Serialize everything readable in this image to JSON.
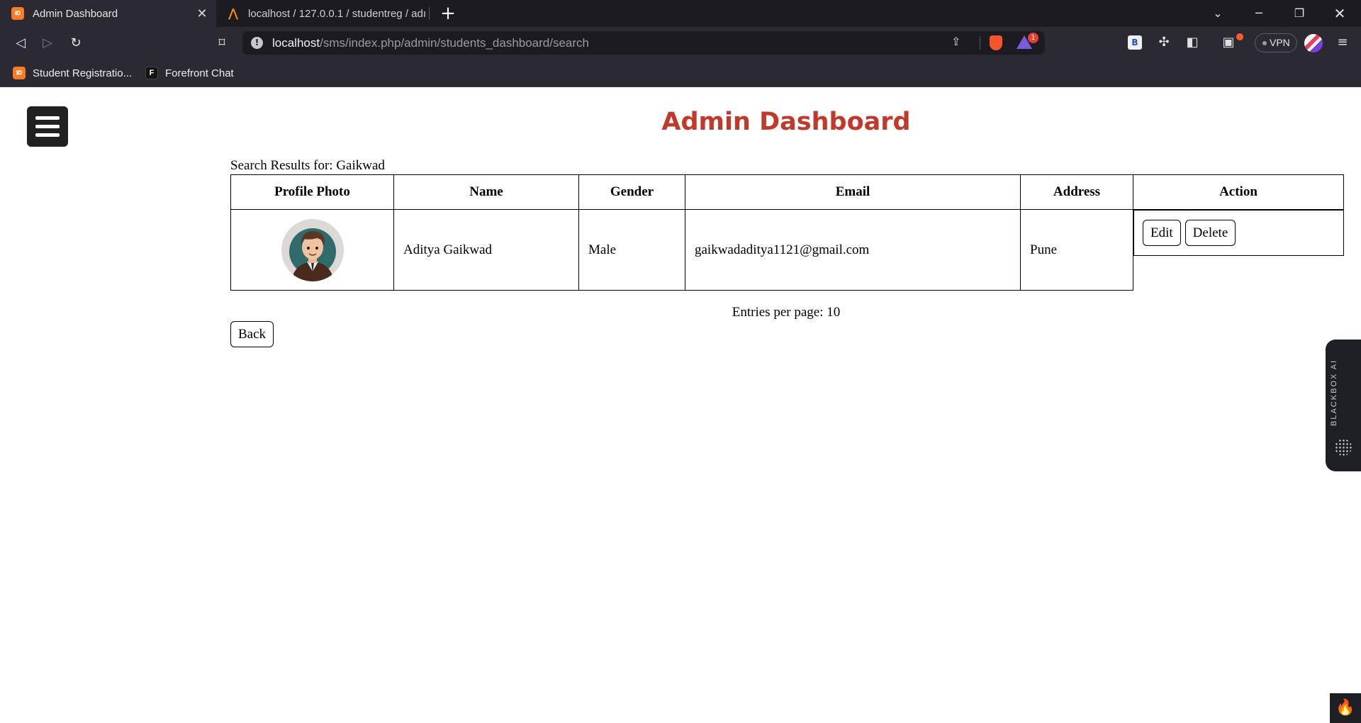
{
  "browser": {
    "tabs": [
      {
        "title": "Admin Dashboard",
        "icon": "xampp-icon",
        "active": true
      },
      {
        "title": "localhost / 127.0.0.1 / studentreg / adı",
        "icon": "phpmyadmin-icon",
        "active": false
      }
    ],
    "address": {
      "host": "localhost",
      "path": "/sms/index.php/admin/students_dashboard/search"
    },
    "rewards_badge": "1",
    "vpn_label": "VPN",
    "extension_b": "B",
    "bookmarks": [
      {
        "label": "Student Registratio...",
        "icon": "xampp-icon"
      },
      {
        "label": "Forefront Chat",
        "icon": "forefront-icon"
      }
    ]
  },
  "page": {
    "title": "Admin Dashboard",
    "search_label": "Search Results for: Gaikwad",
    "table": {
      "headers": [
        "Profile Photo",
        "Name",
        "Gender",
        "Email",
        "Address",
        "Action"
      ],
      "rows": [
        {
          "photo": "avatar",
          "name": "Aditya Gaikwad",
          "gender": "Male",
          "email": "gaikwadaditya1121@gmail.com",
          "address": "Pune",
          "actions": {
            "edit": "Edit",
            "delete": "Delete"
          }
        }
      ]
    },
    "entries_per_page": "Entries per page: 10",
    "back_label": "Back"
  },
  "sidebar_widget": {
    "label": "BLACKBOX AI"
  },
  "colors": {
    "title": "#c0392b",
    "menu_button": "#212121",
    "chrome_bg": "#2b2a33",
    "tabbar_bg": "#1c1b22"
  }
}
